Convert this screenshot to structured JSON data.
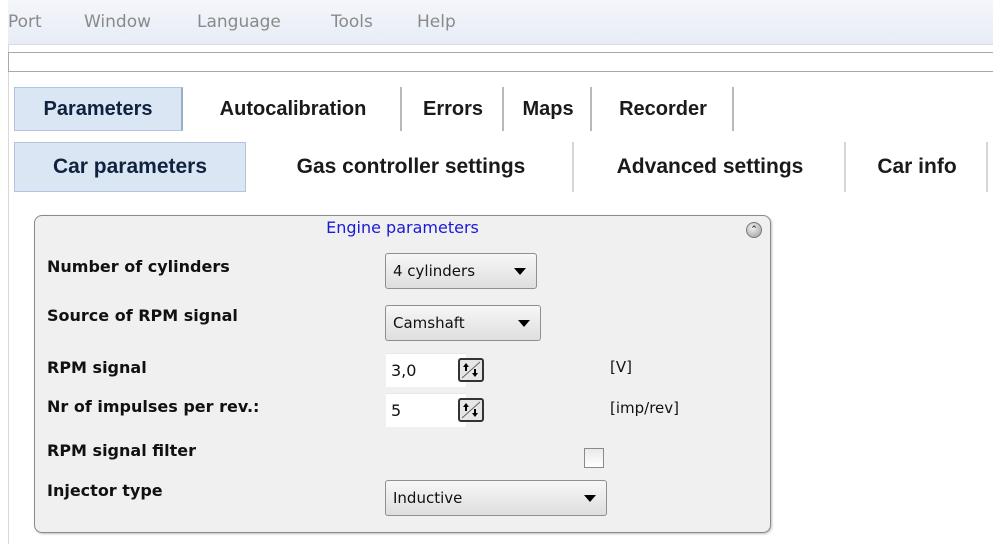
{
  "menu": [
    "Port",
    "Window",
    "Language",
    "Tools",
    "Help"
  ],
  "main_tabs": [
    {
      "label": "Parameters",
      "active": true
    },
    {
      "label": "Autocalibration",
      "active": false
    },
    {
      "label": "Errors",
      "active": false
    },
    {
      "label": "Maps",
      "active": false
    },
    {
      "label": "Recorder",
      "active": false
    }
  ],
  "sub_tabs": [
    {
      "label": "Car parameters",
      "active": true
    },
    {
      "label": "Gas controller settings",
      "active": false
    },
    {
      "label": "Advanced settings",
      "active": false
    },
    {
      "label": "Car info",
      "active": false
    }
  ],
  "panel": {
    "title": "Engine parameters",
    "collapse_icon": "double-chevron-up-icon",
    "rows": {
      "cylinders": {
        "label": "Number of cylinders",
        "value": "4 cylinders"
      },
      "rpm_source": {
        "label": "Source of RPM signal",
        "value": "Camshaft"
      },
      "rpm_signal": {
        "label": "RPM signal",
        "value": "3,0",
        "unit": "[V]"
      },
      "impulses": {
        "label": "Nr of impulses per rev.:",
        "value": "5",
        "unit": "[imp/rev]"
      },
      "rpm_filter": {
        "label": "RPM signal filter",
        "checked": false
      },
      "injector": {
        "label": "Injector type",
        "value": "Inductive"
      }
    }
  },
  "colors": {
    "active_tab_bg": "#dbe6f4",
    "panel_title": "#1a1ad6",
    "panel_bg": "#f0f0f0"
  }
}
